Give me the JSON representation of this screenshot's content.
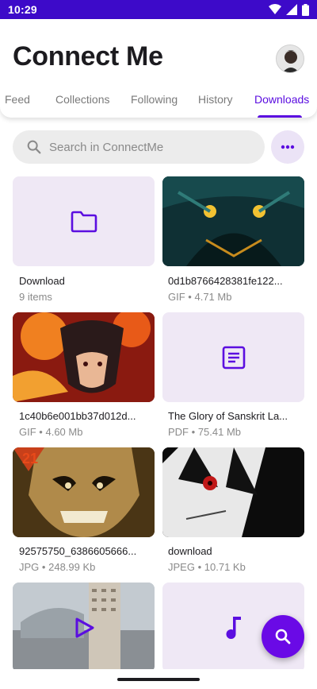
{
  "status_bar": {
    "time": "10:29"
  },
  "app": {
    "title": "Connect Me"
  },
  "tabs": [
    {
      "label": "Feed"
    },
    {
      "label": "Collections"
    },
    {
      "label": "Following"
    },
    {
      "label": "History"
    },
    {
      "label": "Downloads",
      "active": true
    }
  ],
  "search": {
    "placeholder": "Search in ConnectMe"
  },
  "items": [
    {
      "name": "Download",
      "meta": "9 items",
      "kind": "folder"
    },
    {
      "name": "0d1b8766428381fe122...",
      "type": "GIF",
      "size": "4.71 Mb",
      "kind": "image"
    },
    {
      "name": "1c40b6e001bb37d012d...",
      "type": "GIF",
      "size": "4.60 Mb",
      "kind": "image"
    },
    {
      "name": "The Glory of Sanskrit La...",
      "type": "PDF",
      "size": "75.41 Mb",
      "kind": "document"
    },
    {
      "name": "92575750_6386605666...",
      "type": "JPG",
      "size": "248.99 Kb",
      "kind": "image"
    },
    {
      "name": "download",
      "type": "JPEG",
      "size": "10.71 Kb",
      "kind": "image"
    },
    {
      "kind": "video"
    },
    {
      "kind": "audio"
    }
  ],
  "meta_separator": "•",
  "colors": {
    "accent": "#5b0ee0",
    "status_bar": "#3d0ac9",
    "tile_bg": "#efe8f5",
    "fab": "#6a0ae6"
  }
}
